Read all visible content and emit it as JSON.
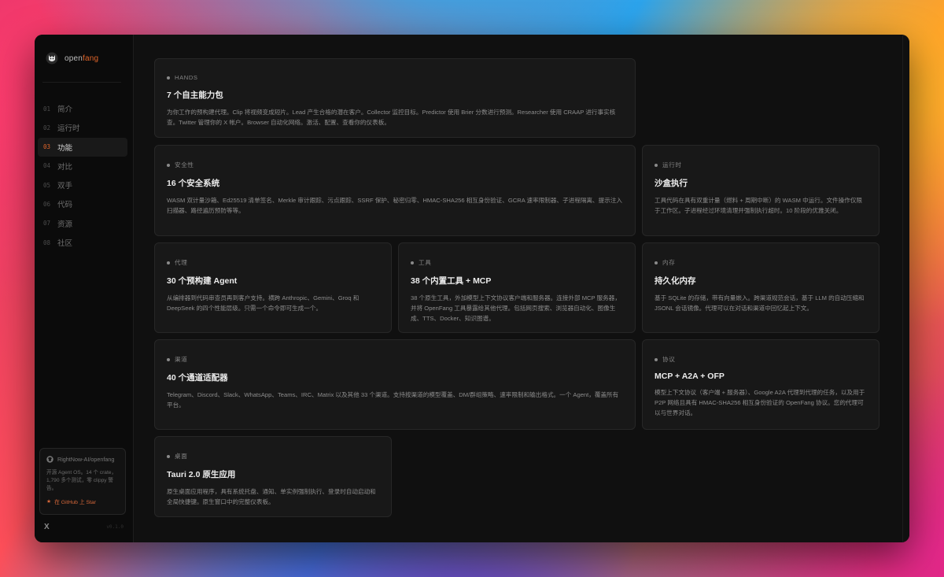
{
  "brand": {
    "name_prefix": "open",
    "name_accent": "fang"
  },
  "nav": [
    {
      "num": "01",
      "label": "简介"
    },
    {
      "num": "02",
      "label": "运行时"
    },
    {
      "num": "03",
      "label": "功能"
    },
    {
      "num": "04",
      "label": "对比"
    },
    {
      "num": "05",
      "label": "双手"
    },
    {
      "num": "06",
      "label": "代码"
    },
    {
      "num": "07",
      "label": "资源"
    },
    {
      "num": "08",
      "label": "社区"
    }
  ],
  "active_nav": "03",
  "repo": {
    "name": "RightNow-AI/openfang",
    "desc": "开源 Agent OS。14 个 crate，1,790 多个测试，零 clippy 警告。",
    "star_label": "在 GitHub 上 Star"
  },
  "footer": {
    "x_label": "X",
    "version": "v0.1.0"
  },
  "cards": [
    {
      "tag": "HANDS",
      "title": "7 个自主能力包",
      "desc": "为你工作的预构建代理。Clip 将视频变成短片。Lead 产生合格的潜在客户。Collector 监控目标。Predictor 使用 Brier 分数进行预测。Researcher 使用 CRAAP 进行事实核查。Twitter 管理你的 X 帐户。Browser 自动化网络。激活、配置、查看你的仪表板。"
    },
    {
      "tag": "安全性",
      "title": "16 个安全系统",
      "desc": "WASM 双计量沙箱、Ed25519 清单签名、Merkle 审计跟踪、污点跟踪、SSRF 保护、秘密归零、HMAC-SHA256 相互身份验证、GCRA 速率限制器、子进程隔离、提示注入扫描器、路径遍历预防等等。"
    },
    {
      "tag": "运行时",
      "title": "沙盒执行",
      "desc": "工具代码在具有双重计量（燃料 + 周期中断）的 WASM 中运行。文件操作仅限于工作区。子进程经过环境清理并强制执行超时。10 阶段的优雅关闭。"
    },
    {
      "tag": "代理",
      "title": "30 个预构建 Agent",
      "desc": "从编排器到代码审查员再到客户支持。横跨 Anthropic、Gemini、Groq 和 DeepSeek 的四个性能层级。只需一个命令即可生成一个。"
    },
    {
      "tag": "工具",
      "title": "38 个内置工具 + MCP",
      "desc": "38 个原生工具，外加模型上下文协议客户端和服务器。连接外部 MCP 服务器，并将 OpenFang 工具暴露给其他代理。包括网页搜索、浏览器自动化、图像生成、TTS、Docker、知识图谱。"
    },
    {
      "tag": "内存",
      "title": "持久化内存",
      "desc": "基于 SQLite 的存储，带有向量嵌入。跨渠道规范会话，基于 LLM 的自动压缩和 JSONL 会话镜像。代理可以在对话和渠道中回忆起上下文。"
    },
    {
      "tag": "渠道",
      "title": "40 个通道适配器",
      "desc": "Telegram、Discord、Slack、WhatsApp、Teams、IRC、Matrix 以及其他 33 个渠道。支持按渠道的模型覆盖、DM/群组策略、速率限制和输出格式。一个 Agent，覆盖所有平台。"
    },
    {
      "tag": "协议",
      "title": "MCP + A2A + OFP",
      "desc": "模型上下文协议（客户端 + 服务器）、Google A2A 代理到代理的任务，以及用于 P2P 网络且具有 HMAC-SHA256 相互身份验证的 OpenFang 协议。您的代理可以与世界对话。"
    },
    {
      "tag": "桌面",
      "title": "Tauri 2.0 原生应用",
      "desc": "原生桌面应用程序，具有系统托盘、通知、单实例强制执行、登录时自动启动和全局快捷键。原生窗口中的完整仪表板。"
    }
  ]
}
